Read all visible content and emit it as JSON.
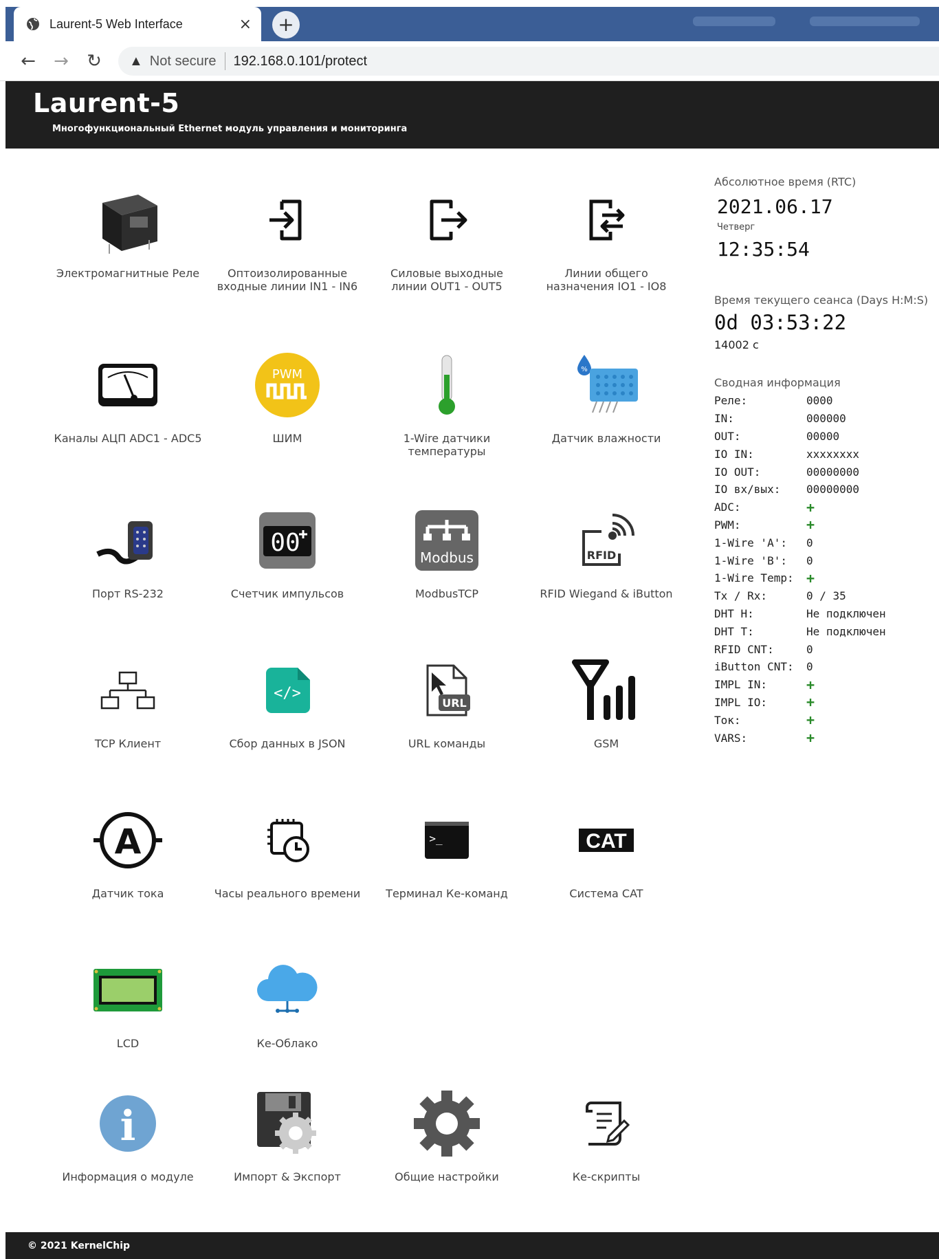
{
  "browser": {
    "tab_title": "Laurent-5 Web Interface",
    "close_glyph": "×",
    "newtab_glyph": "+",
    "back_glyph": "←",
    "forward_glyph": "→",
    "reload_glyph": "↻",
    "warning_glyph": "▲",
    "security_label": "Not secure",
    "url": "192.168.0.101/protect"
  },
  "header": {
    "title": "Laurent-5",
    "subtitle": "Многофункциональный Ethernet модуль управления и мониторинга"
  },
  "modules": [
    {
      "label": "Электромагнитные Реле",
      "icon": "relay-icon"
    },
    {
      "label": "Оптоизолированные\nвходные линии IN1 - IN6",
      "icon": "input-icon"
    },
    {
      "label": "Силовые выходные\nлинии OUT1 - OUT5",
      "icon": "output-icon"
    },
    {
      "label": "Линии общего\nназначения IO1 - IO8",
      "icon": "io-icon"
    },
    {
      "label": "Каналы АЦП ADC1 - ADC5",
      "icon": "gauge-icon"
    },
    {
      "label": "ШИМ",
      "icon": "pwm-icon",
      "icon_text": "PWM"
    },
    {
      "label": "1-Wire датчики\nтемпературы",
      "icon": "thermometer-icon"
    },
    {
      "label": "Датчик влажности",
      "icon": "humidity-sensor-icon"
    },
    {
      "label": "Порт RS-232",
      "icon": "serial-port-icon"
    },
    {
      "label": "Счетчик импульсов",
      "icon": "counter-icon",
      "icon_text": "00"
    },
    {
      "label": "ModbusTCP",
      "icon": "modbus-icon",
      "icon_text": "Modbus"
    },
    {
      "label": "RFID Wiegand & iButton",
      "icon": "rfid-icon",
      "icon_text": "RFID"
    },
    {
      "label": "TCP Клиент",
      "icon": "network-icon"
    },
    {
      "label": "Сбор данных в JSON",
      "icon": "code-file-icon",
      "icon_text": "</>"
    },
    {
      "label": "URL команды",
      "icon": "url-file-icon",
      "icon_text": "URL"
    },
    {
      "label": "GSM",
      "icon": "gsm-antenna-icon"
    },
    {
      "label": "Датчик тока",
      "icon": "ammeter-icon",
      "icon_text": "A"
    },
    {
      "label": "Часы реального времени",
      "icon": "rtc-chip-icon"
    },
    {
      "label": "Терминал Ке-команд",
      "icon": "terminal-icon",
      "icon_text": ">_"
    },
    {
      "label": "Система CAT",
      "icon": "cat-icon",
      "icon_text": "CAT"
    },
    {
      "label": "LCD",
      "icon": "lcd-icon"
    },
    {
      "label": "Ке-Облако",
      "icon": "cloud-icon"
    },
    {
      "label": "Информация о модуле",
      "icon": "info-icon",
      "icon_text": "i"
    },
    {
      "label": "Импорт & Экспорт",
      "icon": "floppy-gear-icon"
    },
    {
      "label": "Общие настройки",
      "icon": "gear-icon"
    },
    {
      "label": "Ке-скрипты",
      "icon": "script-icon"
    }
  ],
  "sidebar": {
    "rtc_caption": "Абсолютное время (RTC)",
    "date": "2021.06.17",
    "weekday": "Четверг",
    "time": "12:35:54",
    "session_caption": "Время текущего сеанса (Days H:M:S)",
    "session_time": "0d 03:53:22",
    "session_seconds": "14002 с",
    "summary_caption": "Сводная информация",
    "summary": [
      {
        "k": "Реле:",
        "v": "0000"
      },
      {
        "k": "IN:",
        "v": "000000"
      },
      {
        "k": "OUT:",
        "v": "00000"
      },
      {
        "k": "IO IN:",
        "v": "xxxxxxxx"
      },
      {
        "k": "IO OUT:",
        "v": "00000000"
      },
      {
        "k": "IO вх/вых:",
        "v": "00000000"
      },
      {
        "k": "ADC:",
        "v": "+"
      },
      {
        "k": "PWM:",
        "v": "+"
      },
      {
        "k": "1-Wire 'A':",
        "v": "0"
      },
      {
        "k": "1-Wire 'B':",
        "v": "0"
      },
      {
        "k": "1-Wire Temp:",
        "v": "+"
      },
      {
        "k": "Tx / Rx:",
        "v": "0 / 35"
      },
      {
        "k": "DHT H:",
        "v": "Не подключен"
      },
      {
        "k": "DHT T:",
        "v": "Не подключен"
      },
      {
        "k": "RFID CNT:",
        "v": "0"
      },
      {
        "k": "iButton CNT:",
        "v": "0"
      },
      {
        "k": "IMPL IN:",
        "v": "+"
      },
      {
        "k": "IMPL IO:",
        "v": "+"
      },
      {
        "k": "Ток:",
        "v": "+"
      },
      {
        "k": "VARS:",
        "v": "+"
      }
    ]
  },
  "footer": {
    "text": "© 2021 KernelChip"
  },
  "colors": {
    "header_bg": "#1f1f1f",
    "tabstrip": "#3b5e96",
    "plus_green": "#2a8a2a"
  }
}
